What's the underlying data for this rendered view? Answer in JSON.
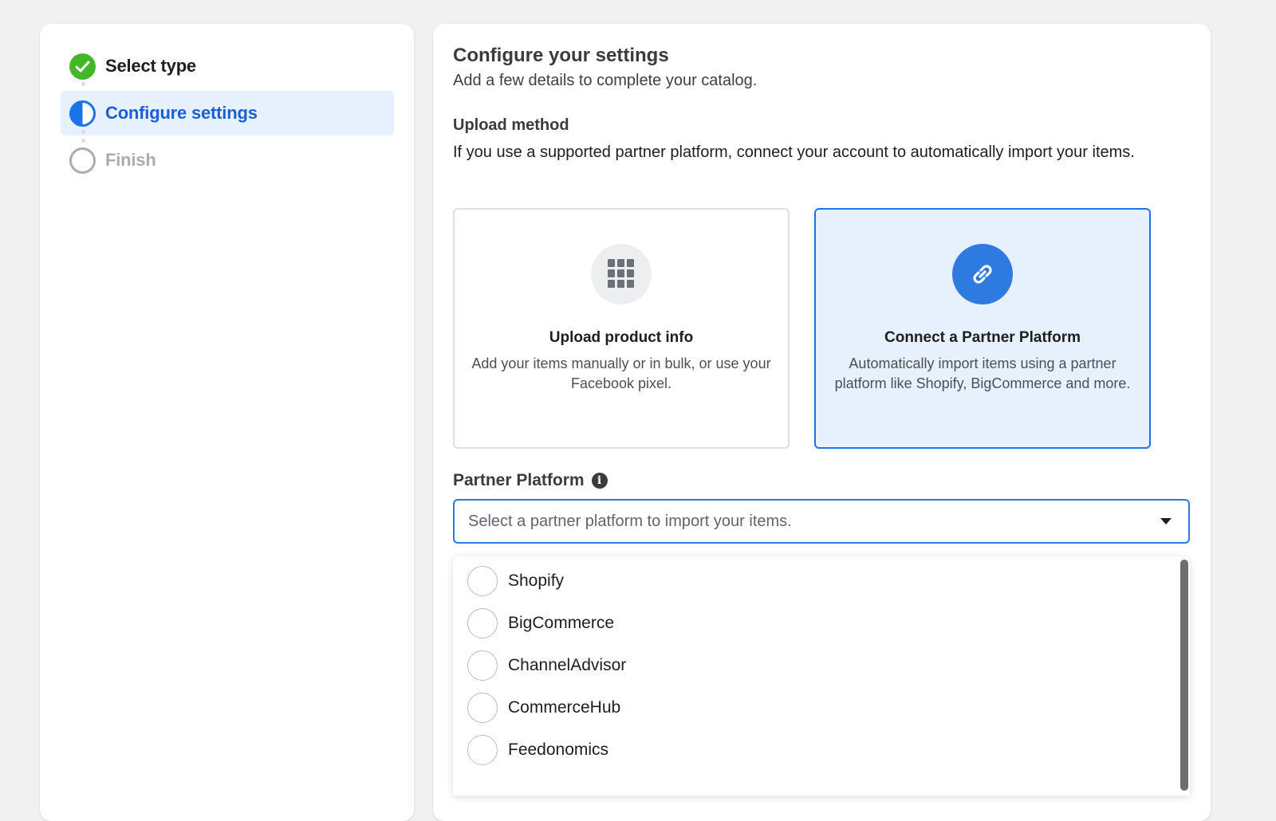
{
  "stepper": {
    "steps": [
      {
        "label": "Select type",
        "state": "complete"
      },
      {
        "label": "Configure settings",
        "state": "active"
      },
      {
        "label": "Finish",
        "state": "pending"
      }
    ]
  },
  "main": {
    "title": "Configure your settings",
    "subtitle": "Add a few details to complete your catalog.",
    "upload_method": {
      "title": "Upload method",
      "description": "If you use a supported partner platform, connect your account to automatically import your items."
    },
    "cards": [
      {
        "icon": "grid-icon",
        "title": "Upload product info",
        "description": "Add your items manually or in bulk, or use your Facebook pixel.",
        "selected": false
      },
      {
        "icon": "link-icon",
        "title": "Connect a Partner Platform",
        "description": "Automatically import items using a partner platform like Shopify, BigCommerce and more.",
        "selected": true
      }
    ],
    "partner_platform": {
      "label": "Partner Platform",
      "info_glyph": "i",
      "placeholder": "Select a partner platform to import your items.",
      "options": [
        "Shopify",
        "BigCommerce",
        "ChannelAdvisor",
        "CommerceHub",
        "Feedonomics"
      ]
    }
  },
  "colors": {
    "accent": "#1a73e8",
    "success": "#42b72a",
    "selected_bg": "#e7f0fd"
  }
}
